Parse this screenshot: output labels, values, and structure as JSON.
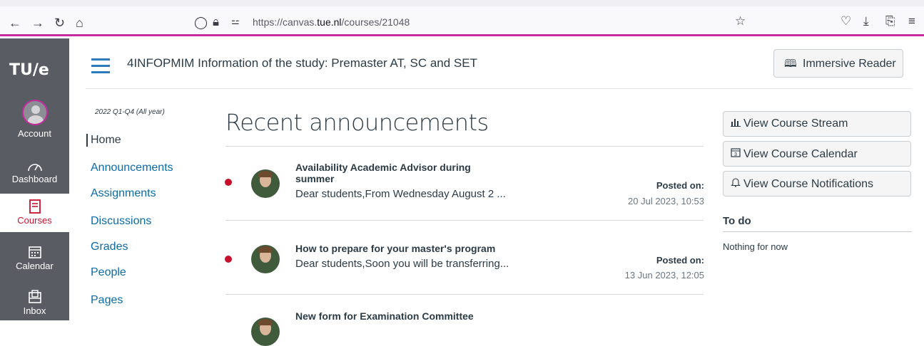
{
  "browser": {
    "url_prefix": "https://canvas.",
    "url_domain": "tue.nl",
    "url_path": "/courses/21048",
    "back_icon": "arrow-left-icon",
    "forward_icon": "arrow-right-icon",
    "reload_icon": "reload-icon",
    "home_icon": "home-icon"
  },
  "global_nav": {
    "logo": "TU/e",
    "items": [
      {
        "label": "Account"
      },
      {
        "label": "Dashboard"
      },
      {
        "label": "Courses"
      },
      {
        "label": "Calendar"
      },
      {
        "label": "Inbox"
      }
    ]
  },
  "header": {
    "course_title": "4INFOPMIM Information of the study: Premaster AT, SC and SET",
    "immersive_reader": "Immersive Reader"
  },
  "course_nav": {
    "term": "2022 Q1-Q4 (All year)",
    "items": [
      {
        "label": "Home"
      },
      {
        "label": "Announcements"
      },
      {
        "label": "Assignments"
      },
      {
        "label": "Discussions"
      },
      {
        "label": "Grades"
      },
      {
        "label": "People"
      },
      {
        "label": "Pages"
      }
    ]
  },
  "main": {
    "heading": "Recent announcements",
    "announcements": [
      {
        "title_line1": "Availability Academic Advisor during",
        "title_line2": "summer",
        "snippet": "Dear students,From Wednesday August 2 ...",
        "posted_label": "Posted on:",
        "posted_date": "20 Jul 2023, 10:53"
      },
      {
        "title_line1": "How to prepare for your master's program",
        "snippet": "Dear students,Soon you will be transferring...",
        "posted_label": "Posted on:",
        "posted_date": "13 Jun 2023, 12:05"
      },
      {
        "title_line1": "New form for Examination Committee"
      }
    ]
  },
  "sidebar": {
    "buttons": [
      {
        "label": "View Course Stream",
        "icon": "bar-chart-icon"
      },
      {
        "label": "View Course Calendar",
        "icon": "calendar-icon"
      },
      {
        "label": "View Course Notifications",
        "icon": "bell-icon"
      }
    ],
    "todo_heading": "To do",
    "todo_empty": "Nothing for now"
  },
  "colors": {
    "accent": "#c42b9d",
    "link": "#0b6ba8",
    "unread": "#c8102e",
    "global_nav_bg": "#5a5c64"
  }
}
